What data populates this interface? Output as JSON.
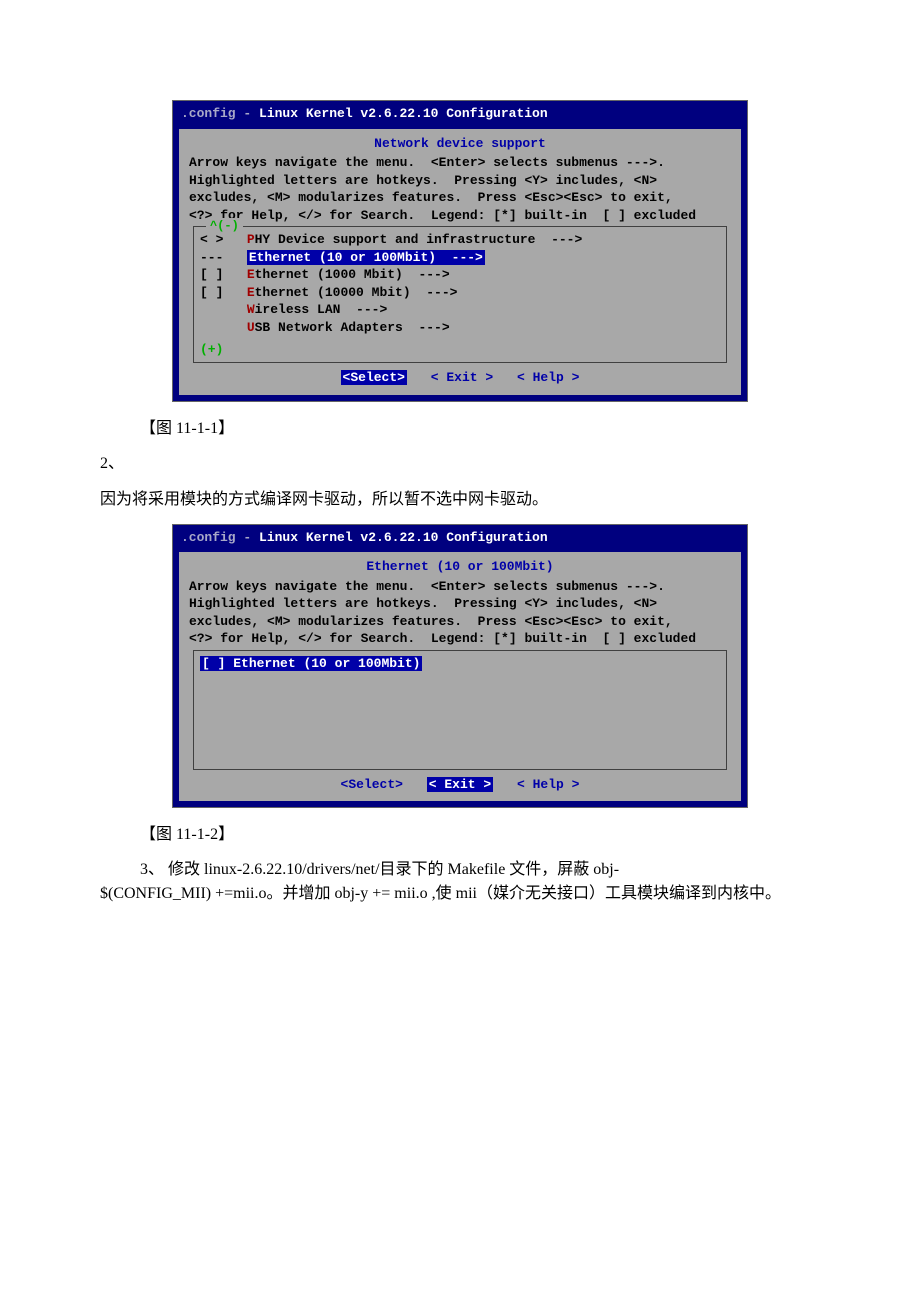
{
  "screenshot1": {
    "title_prefix": ".config - ",
    "title_main": "Linux Kernel v2.6.22.10 Configuration",
    "dialog_title": "Network device support",
    "instr1": "Arrow keys navigate the menu.  <Enter> selects submenus --->.",
    "instr2": "Highlighted letters are hotkeys.  Pressing <Y> includes, <N>",
    "instr3": "excludes, <M> modularizes features.  Press <Esc><Esc> to exit,",
    "instr4": "<?> for Help, </> for Search.  Legend: [*] built-in  [ ] excluded",
    "scroll_up": "^(-)",
    "scroll_down": "(+)",
    "items": {
      "phy_box": "< >   ",
      "phy_hot": "P",
      "phy_rest": "HY Device support and infrastructure  --->",
      "eth10_box": "---   ",
      "eth10_hot": "E",
      "eth10_rest": "thernet (10 or 100Mbit)  --->",
      "eth1000_box": "[ ]   ",
      "eth1000_hot": "E",
      "eth1000_rest": "thernet (1000 Mbit)  --->",
      "eth10000_box": "[ ]   ",
      "eth10000_hot": "E",
      "eth10000_rest": "thernet (10000 Mbit)  --->",
      "wlan_box": "      ",
      "wlan_hot": "W",
      "wlan_rest": "ireless LAN  --->",
      "usb_box": "      ",
      "usb_hot": "U",
      "usb_rest": "SB Network Adapters  --->"
    },
    "btn_select": "<Select>",
    "btn_exit": "< Exit >",
    "btn_help": "< Help >"
  },
  "caption1": "【图 11-1-1】",
  "num2": "2、",
  "para2": "因为将采用模块的方式编译网卡驱动，所以暂不选中网卡驱动。",
  "screenshot2": {
    "title_prefix": ".config - ",
    "title_main": "Linux Kernel v2.6.22.10 Configuration",
    "dialog_title": "Ethernet (10 or 100Mbit)",
    "instr1": "Arrow keys navigate the menu.  <Enter> selects submenus --->.",
    "instr2": "Highlighted letters are hotkeys.  Pressing <Y> includes, <N>",
    "instr3": "excludes, <M> modularizes features.  Press <Esc><Esc> to exit,",
    "instr4": "<?> for Help, </> for Search.  Legend: [*] built-in  [ ] excluded",
    "item_box": "[ ] ",
    "item_hot": "E",
    "item_rest": "thernet (10 or 100Mbit)",
    "btn_select": "<Select>",
    "btn_exit": "< Exit >",
    "btn_help": "< Help >"
  },
  "caption2": "【图 11-1-2】",
  "num3": "3、 ",
  "para3a": "修改 linux-2.6.22.10/drivers/net/目录下的 Makefile 文件，屏蔽 obj-",
  "para3b": "$(CONFIG_MII) +=mii.o。并增加 obj-y += mii.o ,使 mii（媒介无关接口）工具模块编译到内核中。"
}
